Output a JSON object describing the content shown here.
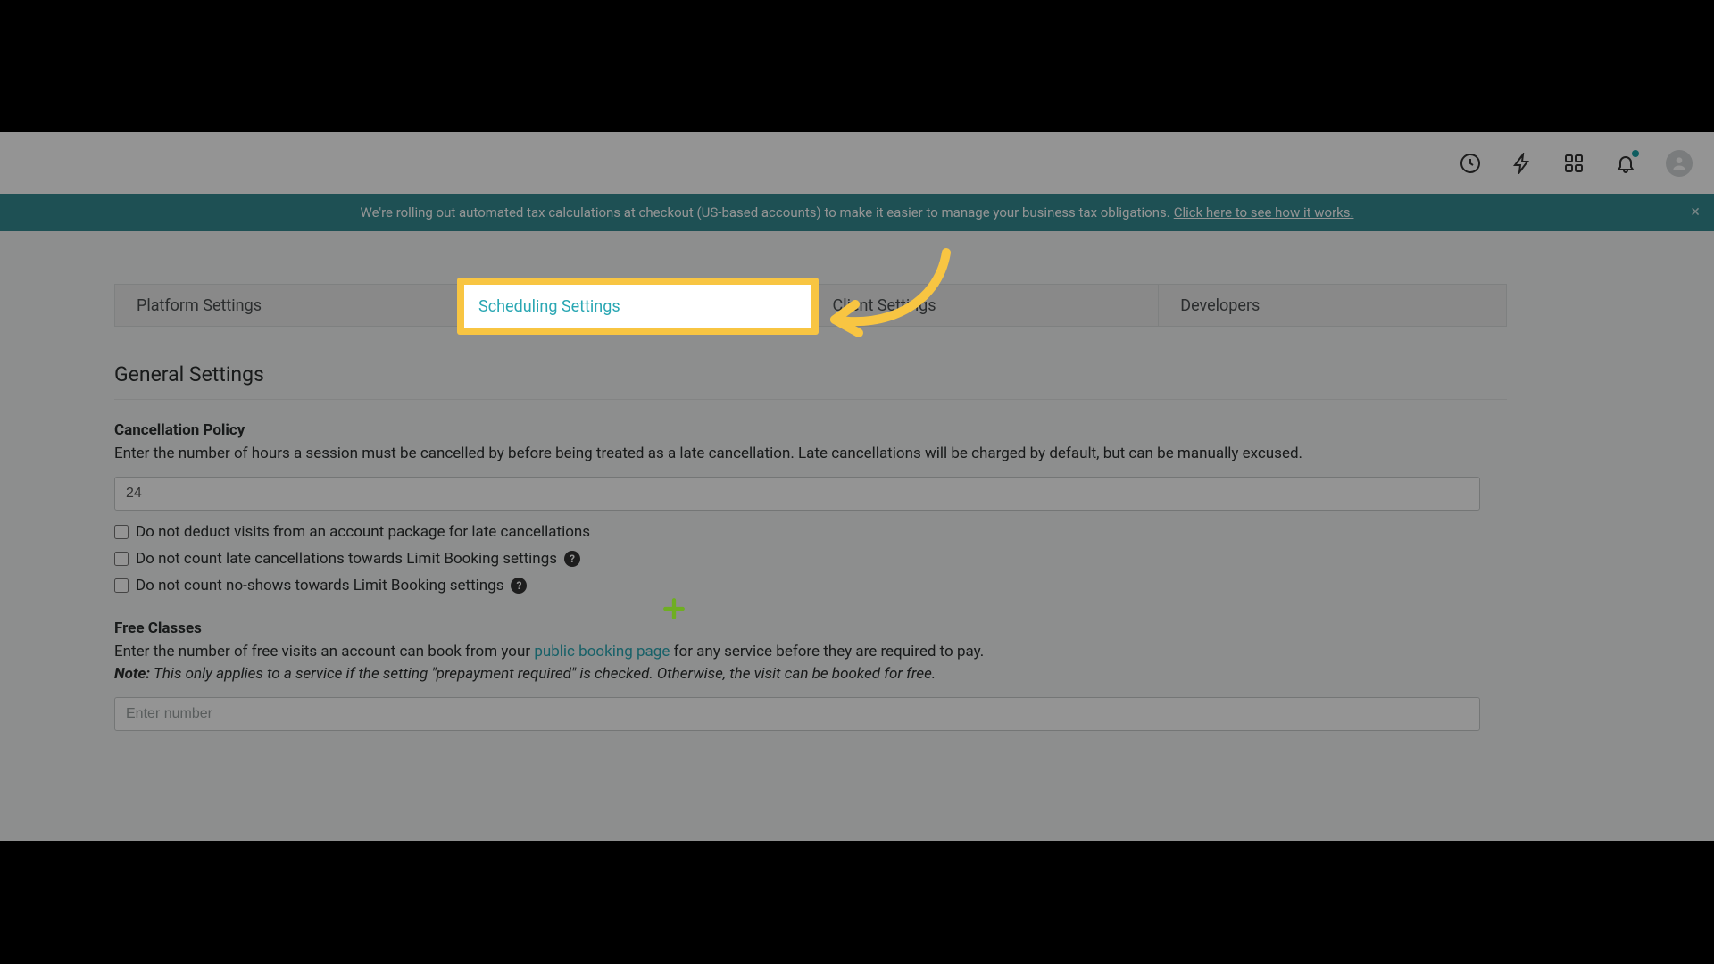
{
  "header": {
    "icons": {
      "history": "clock-icon",
      "lightning": "lightning-icon",
      "apps": "apps-icon",
      "bell": "bell-icon",
      "avatar": "avatar-icon"
    }
  },
  "banner": {
    "text": "We're rolling out automated tax calculations at checkout (US-based accounts) to make it easier to manage your business tax obligations.",
    "link": "Click here to see how it works."
  },
  "tabs": {
    "platform": "Platform Settings",
    "scheduling": "Scheduling Settings",
    "client": "Client Settings",
    "developers": "Developers"
  },
  "general": {
    "title": "General Settings"
  },
  "cancellation": {
    "label": "Cancellation Policy",
    "desc": "Enter the number of hours a session must be cancelled by before being treated as a late cancellation. Late cancellations will be charged by default, but can be manually excused.",
    "value": "24",
    "check1": "Do not deduct visits from an account package for late cancellations",
    "check2": "Do not count late cancellations towards Limit Booking settings",
    "check3": "Do not count no-shows towards Limit Booking settings"
  },
  "free": {
    "label": "Free Classes",
    "desc_pre": "Enter the number of free visits an account can book from your ",
    "desc_link": "public booking page",
    "desc_post": " for any service before they are required to pay.",
    "note_label": "Note:",
    "note_text": " This only applies to a service if the setting \"prepayment required\" is checked. Otherwise, the visit can be booked for free.",
    "placeholder": "Enter number"
  },
  "highlight": {
    "tab_label": "Scheduling Settings"
  }
}
